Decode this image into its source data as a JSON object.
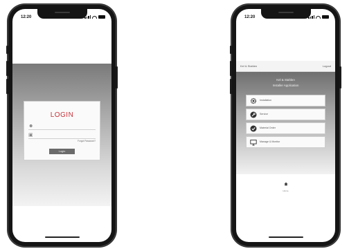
{
  "status_bar": {
    "time": "12:20"
  },
  "login_screen": {
    "title": "LOGIN",
    "username_placeholder": "",
    "password_placeholder": "",
    "forgot_label": "Forgot Password?",
    "login_button": "Login"
  },
  "menu_screen": {
    "top_left": "Kel & Stahlen",
    "top_right": "Logout",
    "title_line1": "Kel & Stahlen",
    "title_line2": "Installer Application",
    "items": [
      {
        "label": "Installation",
        "icon": "gear-icon"
      },
      {
        "label": "Service",
        "icon": "wrench-icon"
      },
      {
        "label": "Material Order",
        "icon": "check-circle-icon"
      },
      {
        "label": "Manage & Monitor",
        "icon": "monitor-icon"
      }
    ],
    "home_label": "Home"
  }
}
